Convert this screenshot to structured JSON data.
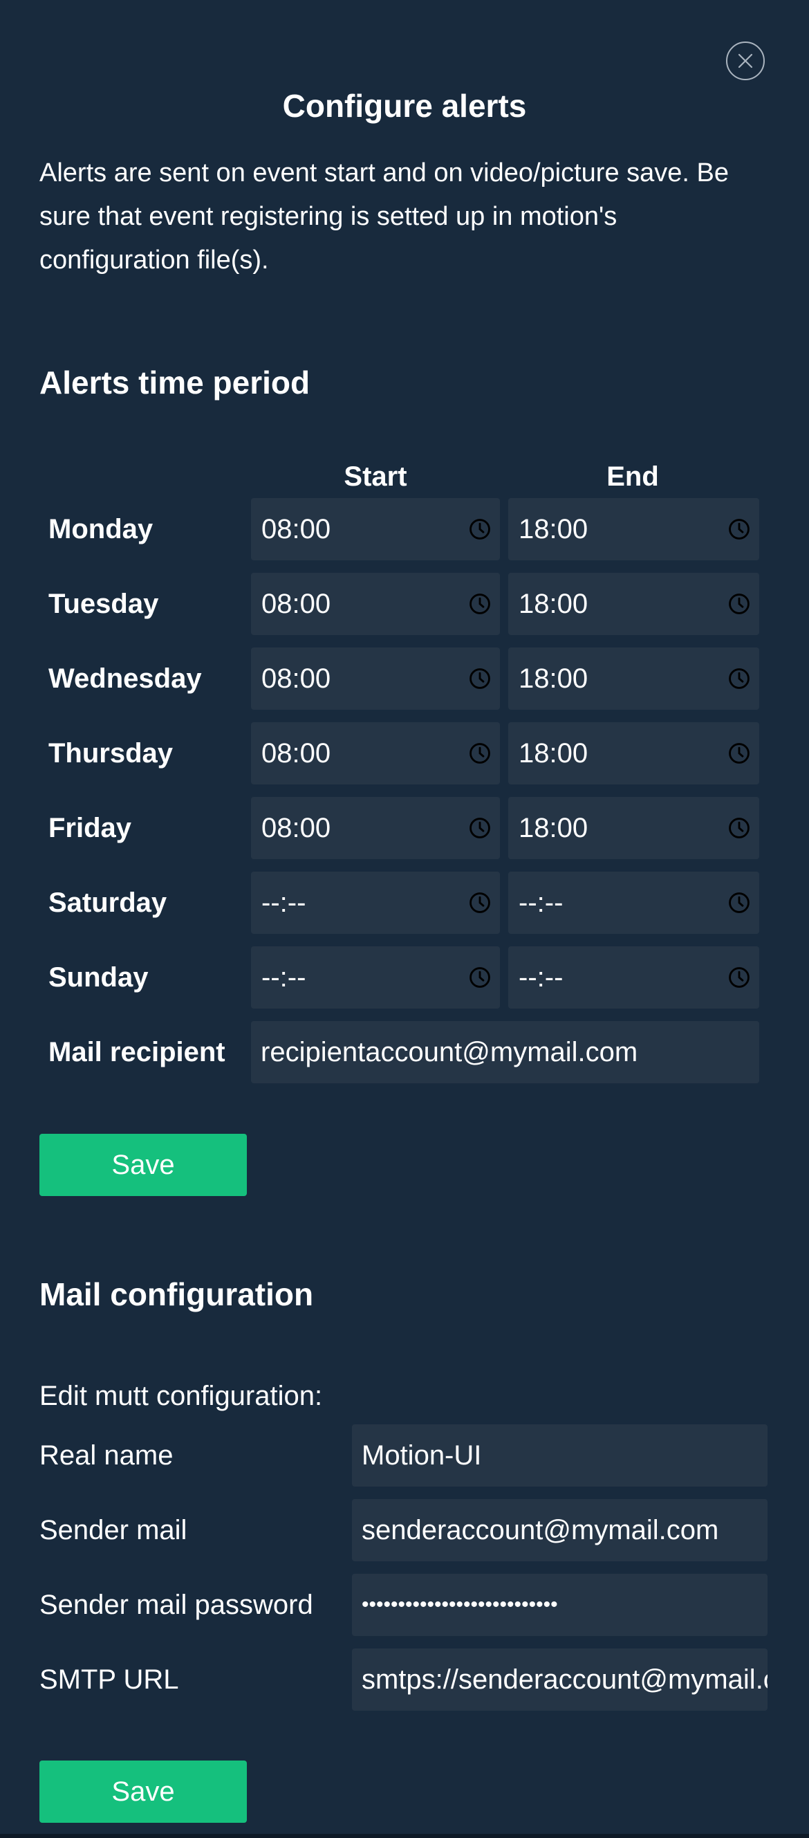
{
  "dialog": {
    "title": "Configure alerts",
    "intro": "Alerts are sent on event start and on video/picture save. Be sure that event registering is setted up in motion's configuration file(s).",
    "close_icon": "close-icon"
  },
  "alerts": {
    "section_title": "Alerts time period",
    "start_header": "Start",
    "end_header": "End",
    "days": [
      {
        "label": "Monday",
        "start": "08:00",
        "end": "18:00"
      },
      {
        "label": "Tuesday",
        "start": "08:00",
        "end": "18:00"
      },
      {
        "label": "Wednesday",
        "start": "08:00",
        "end": "18:00"
      },
      {
        "label": "Thursday",
        "start": "08:00",
        "end": "18:00"
      },
      {
        "label": "Friday",
        "start": "08:00",
        "end": "18:00"
      },
      {
        "label": "Saturday",
        "start": "--:--",
        "end": "--:--"
      },
      {
        "label": "Sunday",
        "start": "--:--",
        "end": "--:--"
      }
    ],
    "recipient_label": "Mail recipient",
    "recipient_value": "recipientaccount@mymail.com",
    "save_label": "Save",
    "clock_icon": "clock-icon"
  },
  "mail": {
    "section_title": "Mail configuration",
    "edit_label": "Edit mutt configuration:",
    "real_name_label": "Real name",
    "real_name_value": "Motion-UI",
    "sender_mail_label": "Sender mail",
    "sender_mail_value": "senderaccount@mymail.com",
    "password_label": "Sender mail password",
    "password_value": "•••••••••••••••••••••••••••",
    "smtp_label": "SMTP URL",
    "smtp_value": "smtps://senderaccount@mymail.com",
    "save_label": "Save"
  },
  "colors": {
    "background": "#182a3d",
    "input_background": "#253546",
    "save_button": "#15c07d",
    "text": "#ffffff"
  }
}
